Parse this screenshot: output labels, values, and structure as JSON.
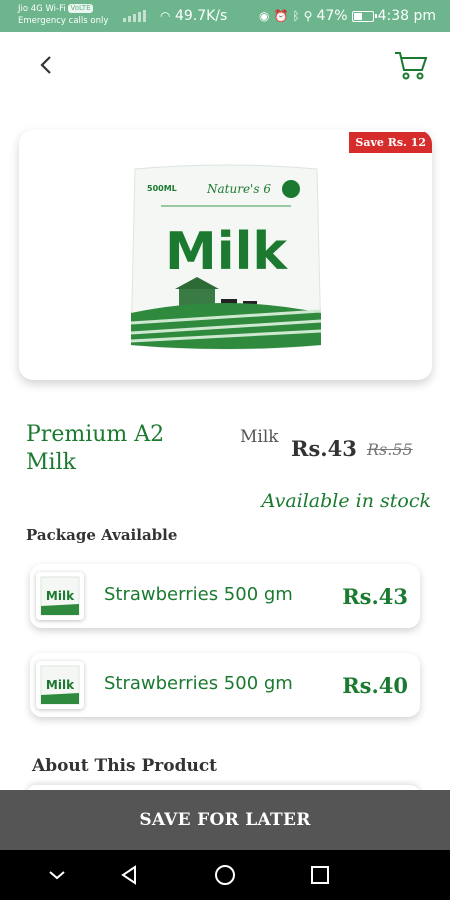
{
  "status_bar": {
    "carrier_line1": "Jio 4G Wi-Fi",
    "carrier_badge": "VoLTE",
    "carrier_line2": "Emergency calls only",
    "network_speed": "49.7K/s",
    "battery": "47%",
    "battery_level": 0.47,
    "time": "4:38 pm"
  },
  "header": {
    "back_icon": "chevron-left-icon",
    "cart_icon": "cart-icon"
  },
  "product": {
    "save_badge": "Save Rs. 12",
    "title": "Premium A2 Milk",
    "category": "Milk",
    "price": "Rs.43",
    "old_price": "Rs.55",
    "stock": "Available in stock",
    "image": {
      "pack_size": "500ML",
      "brand": "Nature's 6",
      "label": "Milk"
    }
  },
  "packages": {
    "title": "Package Available",
    "items": [
      {
        "name": "Strawberries 500 gm",
        "price": "Rs.43",
        "thumb_label": "Milk"
      },
      {
        "name": "Strawberries 500 gm",
        "price": "Rs.40",
        "thumb_label": "Milk"
      }
    ]
  },
  "about": {
    "title": "About This Product"
  },
  "actions": {
    "save_for_later": "SAVE FOR LATER"
  },
  "colors": {
    "status_bar": "#6cb58d",
    "brand_green": "#1b7a30",
    "badge_red": "#d62c2c",
    "button_gray": "#555555"
  }
}
